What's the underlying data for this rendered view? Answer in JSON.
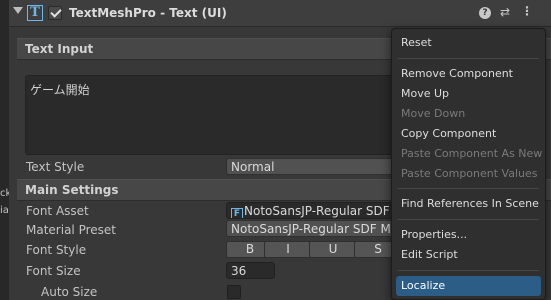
{
  "left_strip": {
    "labels": [
      "ck",
      "iai"
    ]
  },
  "header": {
    "title": "TextMeshPro - Text (UI)",
    "enabled": true,
    "icons": [
      "fold-triangle-icon",
      "text-component-icon",
      "help-icon",
      "presets-icon",
      "kebab-menu-icon"
    ]
  },
  "text_input": {
    "section_title": "Text Input",
    "value": "ゲーム開始",
    "text_style_label": "Text Style",
    "text_style_value": "Normal"
  },
  "main_settings": {
    "section_title": "Main Settings",
    "font_asset_label": "Font Asset",
    "font_asset_value": "NotoSansJP-Regular SDF (TMP_FontAsset)",
    "material_preset_label": "Material Preset",
    "material_preset_value": "NotoSansJP-Regular SDF Material",
    "font_style_label": "Font Style",
    "font_style_buttons": [
      "B",
      "I",
      "U",
      "S"
    ],
    "font_size_label": "Font Size",
    "font_size_value": "36",
    "auto_size_label": "Auto Size",
    "auto_size_checked": false
  },
  "context_menu": {
    "items": [
      {
        "label": "Reset",
        "enabled": true
      },
      {
        "label": "Remove Component",
        "enabled": true
      },
      {
        "label": "Move Up",
        "enabled": true
      },
      {
        "label": "Move Down",
        "enabled": false
      },
      {
        "label": "Copy Component",
        "enabled": true
      },
      {
        "label": "Paste Component As New",
        "enabled": false
      },
      {
        "label": "Paste Component Values",
        "enabled": false
      },
      {
        "label": "Find References In Scene",
        "enabled": true
      },
      {
        "label": "Properties...",
        "enabled": true
      },
      {
        "label": "Edit Script",
        "enabled": true
      },
      {
        "label": "Localize",
        "enabled": true,
        "selected": true
      }
    ]
  },
  "colors": {
    "background": "#383838",
    "header": "#3e3e3e",
    "section": "#474747",
    "menu": "#2f2f2f",
    "menu_highlight": "#2c5d87",
    "icon_accent": "#6fb6e9"
  }
}
